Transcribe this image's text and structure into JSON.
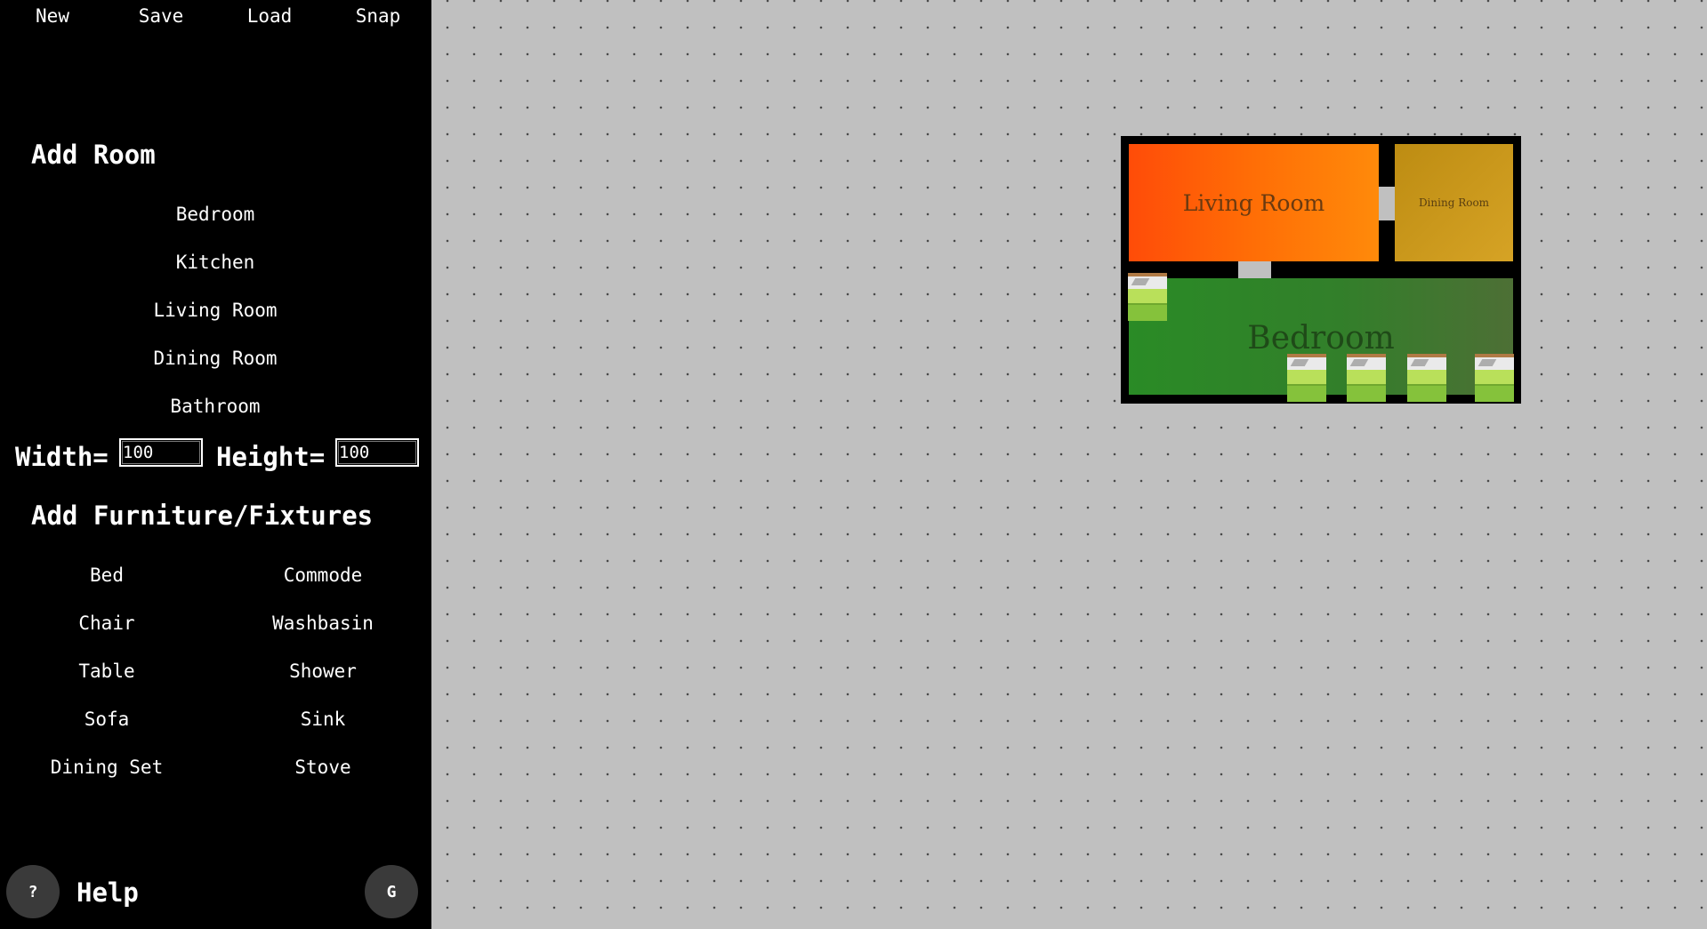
{
  "menu": {
    "new_label": "New",
    "save_label": "Save",
    "load_label": "Load",
    "snap_label": "Snap"
  },
  "add_room": {
    "title": "Add Room",
    "rooms": [
      "Bedroom",
      "Kitchen",
      "Living Room",
      "Dining Room",
      "Bathroom"
    ],
    "width_label": "Width=",
    "width_value": "100",
    "height_label": "Height=",
    "height_value": "100"
  },
  "add_furniture": {
    "title": "Add Furniture/Fixtures",
    "left_column": [
      "Bed",
      "Chair",
      "Table",
      "Sofa",
      "Dining Set"
    ],
    "right_column": [
      "Commode",
      "Washbasin",
      "Shower",
      "Sink",
      "Stove"
    ]
  },
  "footer": {
    "help_button_glyph": "?",
    "help_label": "Help",
    "grid_button_glyph": "G"
  },
  "floorplan": {
    "rooms": {
      "living": {
        "label": "Living Room",
        "color": "#ff6e06"
      },
      "dining": {
        "label": "Dining Room",
        "color": "#c8961a"
      },
      "bedroom": {
        "label": "Bedroom",
        "color": "#2e8a28"
      }
    },
    "wall_color": "#000000",
    "bed_count": 5
  },
  "colors": {
    "sidebar_bg": "#000000",
    "canvas_bg": "#c0c0c0",
    "text": "#ffffff",
    "round_button_bg": "#3a3a3a"
  }
}
